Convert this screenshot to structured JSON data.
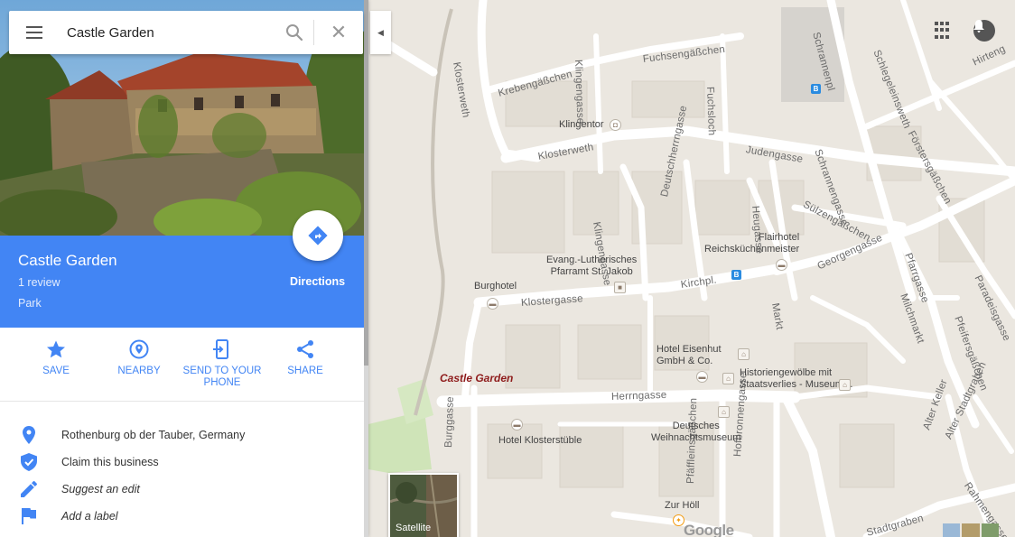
{
  "search": {
    "query": "Castle Garden"
  },
  "place": {
    "name": "Castle Garden",
    "reviews": "1 review",
    "category": "Park",
    "directions_label": "Directions"
  },
  "actions": [
    {
      "label": "SAVE",
      "icon": "star-icon"
    },
    {
      "label": "NEARBY",
      "icon": "nearby-icon"
    },
    {
      "label": "SEND TO YOUR PHONE",
      "line1": "SEND TO YOUR",
      "line2": "PHONE",
      "icon": "send-to-phone-icon"
    },
    {
      "label": "SHARE",
      "icon": "share-icon"
    }
  ],
  "details": [
    {
      "text": "Rothenburg ob der Tauber, Germany",
      "icon": "location-pin-icon"
    },
    {
      "text": "Claim this business",
      "icon": "verified-shield-icon"
    },
    {
      "text": "Suggest an edit",
      "icon": "pencil-icon"
    },
    {
      "text": "Add a label",
      "icon": "flag-icon"
    }
  ],
  "map": {
    "marker_label": "Castle Garden",
    "streets": {
      "klosterweth_v": "Klosterweth",
      "krebengasschen": "Krebengäßchen",
      "klingengasse_top": "Klingengasse",
      "fuchsengasschen": "Fuchsengäßchen",
      "fuchsloch": "Fuchsloch",
      "schrannenpl": "Schrannenpl",
      "schlegeleinsweth": "Schlegeleinsweth",
      "hirtengasse": "Hirteng",
      "klosterweth_h": "Klosterweth",
      "judengasse": "Judengasse",
      "schrannengasse": "Schrannengasse",
      "forstersgasschen": "Förstersgäßchen",
      "klingengasse": "Klingengasse",
      "deutschherrngasse": "Deutschherrngasse",
      "heugasse": "Heugasse",
      "sulzengasschen": "Sülzengäßchen",
      "georgengasse": "Georgengasse",
      "pfarrgasse": "Pfarrgasse",
      "paradeisgasse": "Paradeisgasse",
      "klostergasse": "Klostergasse",
      "kirchpl": "Kirchpl.",
      "markt": "Markt",
      "milchmarkt": "Milchmarkt",
      "pfeifersgasschen": "Pfeifersgäßchen",
      "herrngasse": "Herrngasse",
      "burggasse": "Burggasse",
      "pfaffleinsgasschen": "Pfäffleinsgäßchen",
      "hofbronnengasse": "Hofbronnengasse",
      "alter_keller": "Alter Keller",
      "alter_stadtgraben": "Alter Stadtgraben",
      "rahmengasse": "Rahmengasse",
      "stadtgraben": "Stadtgraben"
    },
    "pois": {
      "klingentor": "Klingentor",
      "flairhotel": "Flairhotel\nReichsküchenmeister",
      "evang": "Evang.-Lutherisches\nPfarramt St. Jakob",
      "burghotel": "Burghotel",
      "hotel_eisenhut": "Hotel Eisenhut\nGmbH & Co.",
      "historiengewolbe": "Historiengewölbe mit\nStaatsverlies - Museum…",
      "hotel_klosterstuble": "Hotel Klosterstüble",
      "weihnachtsmuseum": "Deutsches\nWeihnachtsmuseum",
      "zur_holl": "Zur Höll"
    },
    "satellite_label": "Satellite",
    "google_logo": "Google"
  }
}
